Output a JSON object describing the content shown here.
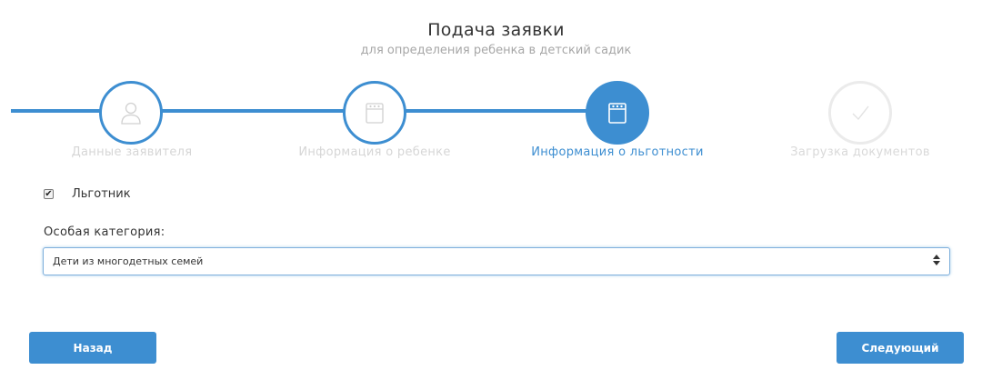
{
  "header": {
    "title": "Подача заявки",
    "subtitle": "для определения ребенка в детский садик"
  },
  "steps": [
    {
      "label": "Данные заявителя",
      "icon": "user-icon",
      "state": "completed"
    },
    {
      "label": "Информация о ребенке",
      "icon": "calendar-icon",
      "state": "completed"
    },
    {
      "label": "Информация о льготности",
      "icon": "calendar-icon",
      "state": "active"
    },
    {
      "label": "Загрузка документов",
      "icon": "check-icon",
      "state": "disabled"
    }
  ],
  "form": {
    "benefit_checkbox": {
      "label": "Льготник",
      "checked": true
    },
    "category": {
      "label": "Особая категория:",
      "selected": "Дети из многодетных семей"
    }
  },
  "buttons": {
    "back": "Назад",
    "next": "Следующий"
  },
  "colors": {
    "accent": "#3d8ed1",
    "muted_text": "#d6d6d6",
    "disabled_circle": "#ebebeb"
  }
}
